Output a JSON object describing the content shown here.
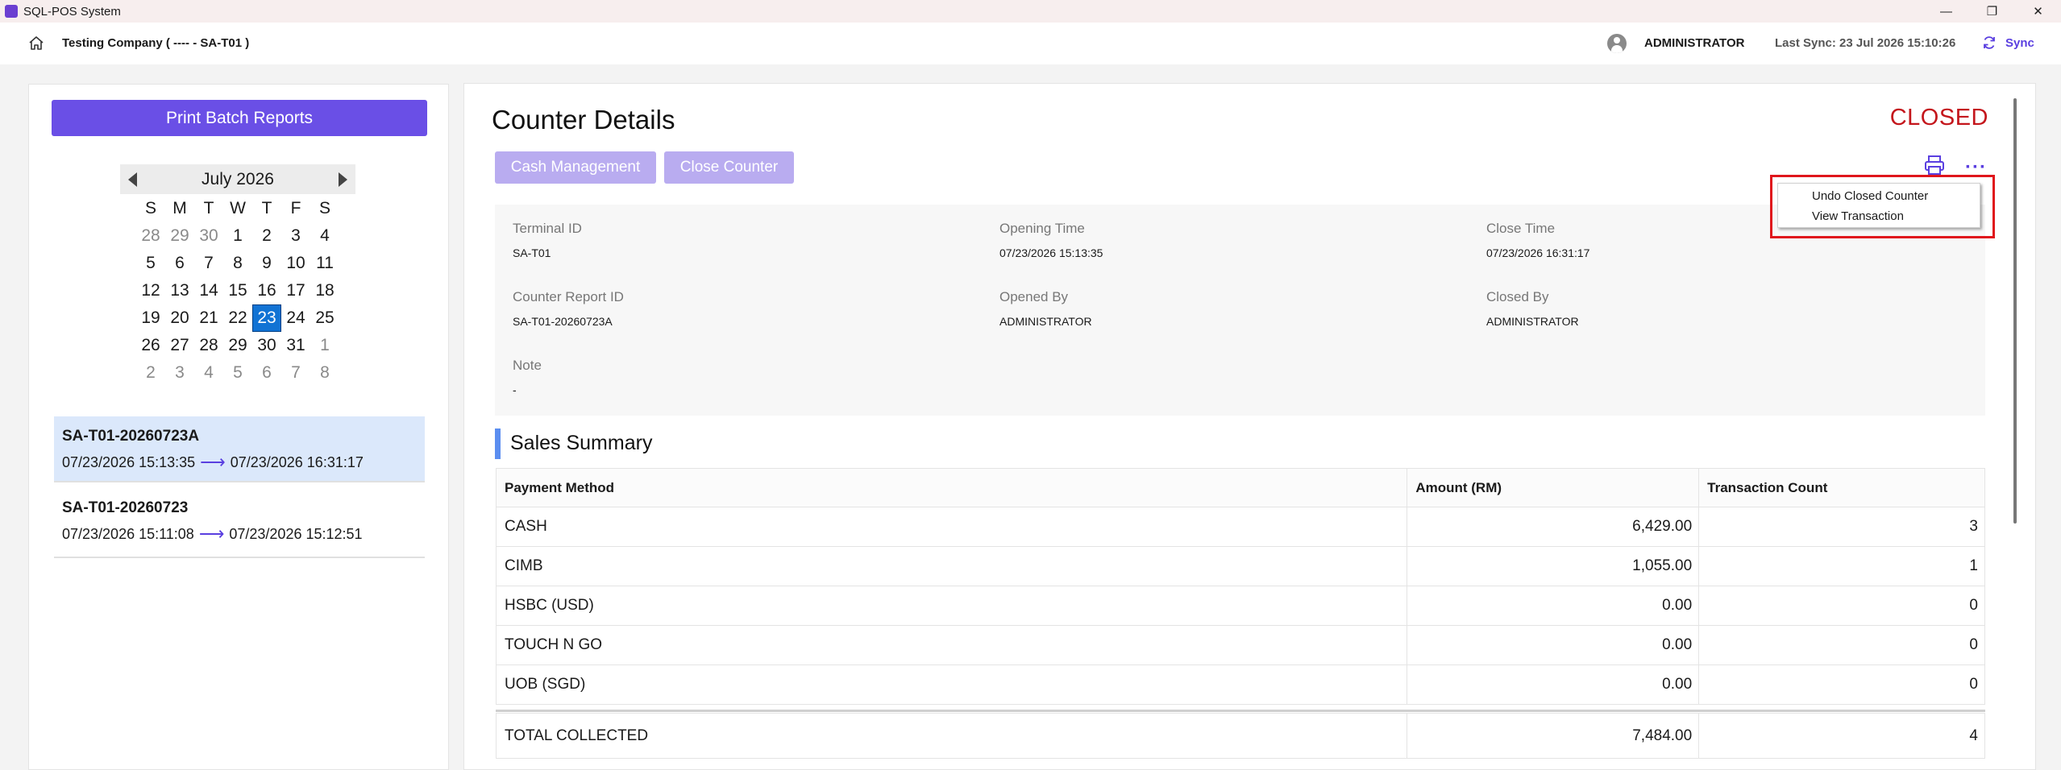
{
  "window": {
    "title": "SQL-POS System",
    "controls": {
      "minimize": "—",
      "restore": "❐",
      "close": "✕"
    }
  },
  "header": {
    "company": "Testing Company ( ---- - SA-T01 )",
    "user": "ADMINISTRATOR",
    "last_sync": "Last Sync: 23 Jul 2026 15:10:26",
    "sync_label": "Sync"
  },
  "left": {
    "print_batch_label": "Print Batch Reports",
    "calendar": {
      "month_label": "July 2026",
      "weekdays": [
        "S",
        "M",
        "T",
        "W",
        "T",
        "F",
        "S"
      ],
      "weeks": [
        [
          {
            "d": "28",
            "dim": true
          },
          {
            "d": "29",
            "dim": true
          },
          {
            "d": "30",
            "dim": true
          },
          {
            "d": "1"
          },
          {
            "d": "2"
          },
          {
            "d": "3"
          },
          {
            "d": "4"
          }
        ],
        [
          {
            "d": "5"
          },
          {
            "d": "6"
          },
          {
            "d": "7"
          },
          {
            "d": "8"
          },
          {
            "d": "9"
          },
          {
            "d": "10"
          },
          {
            "d": "11"
          }
        ],
        [
          {
            "d": "12"
          },
          {
            "d": "13"
          },
          {
            "d": "14"
          },
          {
            "d": "15"
          },
          {
            "d": "16"
          },
          {
            "d": "17"
          },
          {
            "d": "18"
          }
        ],
        [
          {
            "d": "19"
          },
          {
            "d": "20"
          },
          {
            "d": "21"
          },
          {
            "d": "22"
          },
          {
            "d": "23",
            "sel": true
          },
          {
            "d": "24"
          },
          {
            "d": "25"
          }
        ],
        [
          {
            "d": "26"
          },
          {
            "d": "27"
          },
          {
            "d": "28"
          },
          {
            "d": "29"
          },
          {
            "d": "30"
          },
          {
            "d": "31"
          },
          {
            "d": "1",
            "dim": true
          }
        ],
        [
          {
            "d": "2",
            "dim": true
          },
          {
            "d": "3",
            "dim": true
          },
          {
            "d": "4",
            "dim": true
          },
          {
            "d": "5",
            "dim": true
          },
          {
            "d": "6",
            "dim": true
          },
          {
            "d": "7",
            "dim": true
          },
          {
            "d": "8",
            "dim": true
          }
        ]
      ]
    },
    "counters": [
      {
        "id": "SA-T01-20260723A",
        "open": "07/23/2026 15:13:35",
        "close": "07/23/2026 16:31:17"
      },
      {
        "id": "SA-T01-20260723",
        "open": "07/23/2026 15:11:08",
        "close": "07/23/2026 15:12:51"
      }
    ]
  },
  "main": {
    "title": "Counter Details",
    "status": "CLOSED",
    "status_color": "#c4161c",
    "buttons": {
      "cash_management": "Cash Management",
      "close_counter": "Close Counter"
    },
    "details": {
      "terminal_id": {
        "label": "Terminal ID",
        "value": "SA-T01"
      },
      "opening_time": {
        "label": "Opening Time",
        "value": "07/23/2026 15:13:35"
      },
      "close_time": {
        "label": "Close Time",
        "value": "07/23/2026 16:31:17"
      },
      "counter_report_id": {
        "label": "Counter Report ID",
        "value": "SA-T01-20260723A"
      },
      "opened_by": {
        "label": "Opened By",
        "value": "ADMINISTRATOR"
      },
      "closed_by": {
        "label": "Closed By",
        "value": "ADMINISTRATOR"
      },
      "note": {
        "label": "Note",
        "value": "-"
      }
    },
    "sales_summary": {
      "title": "Sales Summary",
      "columns": [
        "Payment Method",
        "Amount (RM)",
        "Transaction Count"
      ],
      "rows": [
        [
          "CASH",
          "6,429.00",
          "3"
        ],
        [
          "CIMB",
          "1,055.00",
          "1"
        ],
        [
          "HSBC (USD)",
          "0.00",
          "0"
        ],
        [
          "TOUCH N GO",
          "0.00",
          "0"
        ],
        [
          "UOB (SGD)",
          "0.00",
          "0"
        ]
      ],
      "total": [
        "TOTAL COLLECTED",
        "7,484.00",
        "4"
      ]
    },
    "menu": {
      "items": [
        "Undo Closed Counter",
        "View Transaction"
      ]
    },
    "accent_color": "#5a3fe0"
  }
}
